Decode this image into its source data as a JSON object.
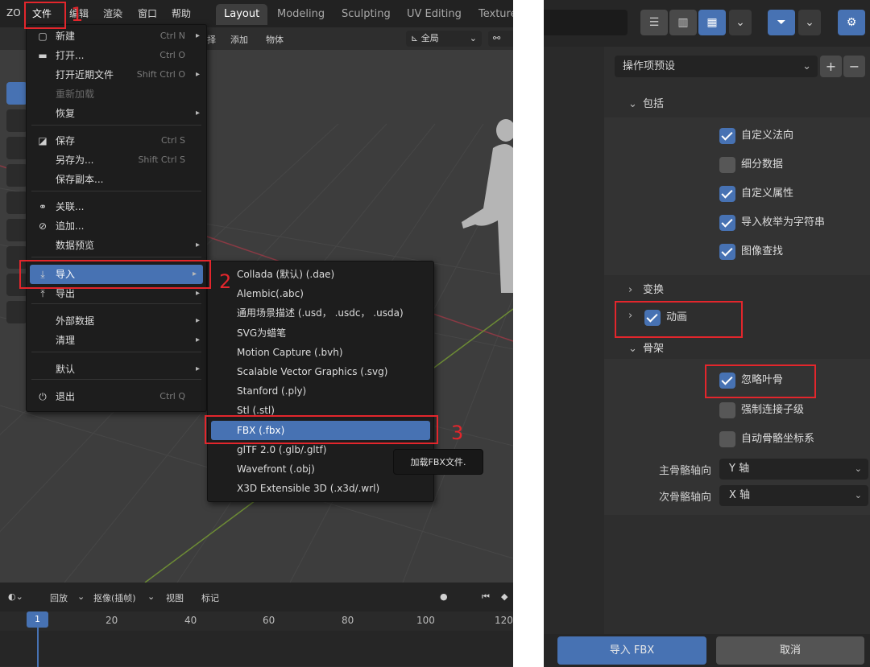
{
  "left": {
    "topbar": {
      "logo": "ZO",
      "menus": [
        "文件",
        "编辑",
        "渲染",
        "窗口",
        "帮助"
      ],
      "workspace_tabs": [
        "Layout",
        "Modeling",
        "Sculpting",
        "UV Editing",
        "Texture"
      ],
      "active_tab": "Layout"
    },
    "viewport_header": {
      "items": [
        "择",
        "添加",
        "物体"
      ],
      "orientation": "全局"
    },
    "file_menu": {
      "items": [
        {
          "icon": "new-file-icon",
          "glyph": "▢",
          "label": "新建",
          "shortcut": "Ctrl N",
          "arrow": "▸"
        },
        {
          "icon": "folder-icon",
          "glyph": "▬",
          "label": "打开...",
          "shortcut": "Ctrl O",
          "arrow": ""
        },
        {
          "icon": "",
          "glyph": "",
          "label": "打开近期文件",
          "shortcut": "Shift Ctrl O",
          "arrow": "▸"
        },
        {
          "icon": "",
          "glyph": "",
          "label": "重新加载",
          "shortcut": "",
          "arrow": "",
          "disabled": true
        },
        {
          "icon": "",
          "glyph": "",
          "label": "恢复",
          "shortcut": "",
          "arrow": "▸"
        },
        {
          "icon": "save-icon",
          "glyph": "◪",
          "label": "保存",
          "shortcut": "Ctrl S",
          "arrow": ""
        },
        {
          "icon": "",
          "glyph": "",
          "label": "另存为...",
          "shortcut": "Shift Ctrl S",
          "arrow": ""
        },
        {
          "icon": "",
          "glyph": "",
          "label": "保存副本...",
          "shortcut": "",
          "arrow": ""
        },
        {
          "icon": "link-icon",
          "glyph": "⚭",
          "label": "关联...",
          "shortcut": "",
          "arrow": ""
        },
        {
          "icon": "append-icon",
          "glyph": "⊘",
          "label": "追加...",
          "shortcut": "",
          "arrow": ""
        },
        {
          "icon": "",
          "glyph": "",
          "label": "数据预览",
          "shortcut": "",
          "arrow": "▸"
        },
        {
          "icon": "import-icon",
          "glyph": "⤓",
          "label": "导入",
          "shortcut": "",
          "arrow": "▸",
          "highlighted": true
        },
        {
          "icon": "export-icon",
          "glyph": "⤒",
          "label": "导出",
          "shortcut": "",
          "arrow": "▸"
        },
        {
          "icon": "",
          "glyph": "",
          "label": "外部数据",
          "shortcut": "",
          "arrow": "▸"
        },
        {
          "icon": "",
          "glyph": "",
          "label": "清理",
          "shortcut": "",
          "arrow": "▸"
        },
        {
          "icon": "",
          "glyph": "",
          "label": "默认",
          "shortcut": "",
          "arrow": "▸"
        },
        {
          "icon": "quit-icon",
          "glyph": "⏻",
          "label": "退出",
          "shortcut": "Ctrl Q",
          "arrow": ""
        }
      ]
    },
    "import_menu": {
      "items": [
        "Collada (默认) (.dae)",
        "Alembic(.abc)",
        "通用场景描述 (.usd， .usdc， .usda)",
        "SVG为蜡笔",
        "Motion Capture (.bvh)",
        "Scalable Vector Graphics (.svg)",
        "Stanford (.ply)",
        "Stl (.stl)",
        "FBX (.fbx)",
        "glTF 2.0 (.glb/.gltf)",
        "Wavefront (.obj)",
        "X3D Extensible 3D (.x3d/.wrl)"
      ],
      "highlighted": "FBX (.fbx)",
      "tooltip": "加载FBX文件."
    },
    "timeline": {
      "header": [
        "回放",
        "抠像(插帧)",
        "视图",
        "标记"
      ],
      "current_frame": "1",
      "ticks": [
        "20",
        "40",
        "60",
        "80",
        "100",
        "120"
      ]
    },
    "annotations": [
      "1",
      "2",
      "3"
    ]
  },
  "right": {
    "preset_label": "操作项预设",
    "sections": {
      "include": {
        "title": "包括",
        "options": [
          {
            "label": "自定义法向",
            "checked": true
          },
          {
            "label": "细分数据",
            "checked": false
          },
          {
            "label": "自定义属性",
            "checked": true
          },
          {
            "label": "导入枚举为字符串",
            "checked": true
          },
          {
            "label": "图像查找",
            "checked": true
          }
        ]
      },
      "transform": {
        "title": "变换"
      },
      "animation": {
        "title": "动画",
        "checked": true
      },
      "armature": {
        "title": "骨架",
        "options": [
          {
            "label": "忽略叶骨",
            "checked": true
          },
          {
            "label": "强制连接子级",
            "checked": false
          },
          {
            "label": "自动骨骼坐标系",
            "checked": false
          }
        ],
        "primary_axis_label": "主骨骼轴向",
        "primary_axis_value": "Y 轴",
        "secondary_axis_label": "次骨骼轴向",
        "secondary_axis_value": "X 轴"
      }
    },
    "buttons": {
      "import": "导入 FBX",
      "cancel": "取消"
    }
  },
  "colors": {
    "accent": "#4772b3",
    "annotation": "#e3262c"
  }
}
